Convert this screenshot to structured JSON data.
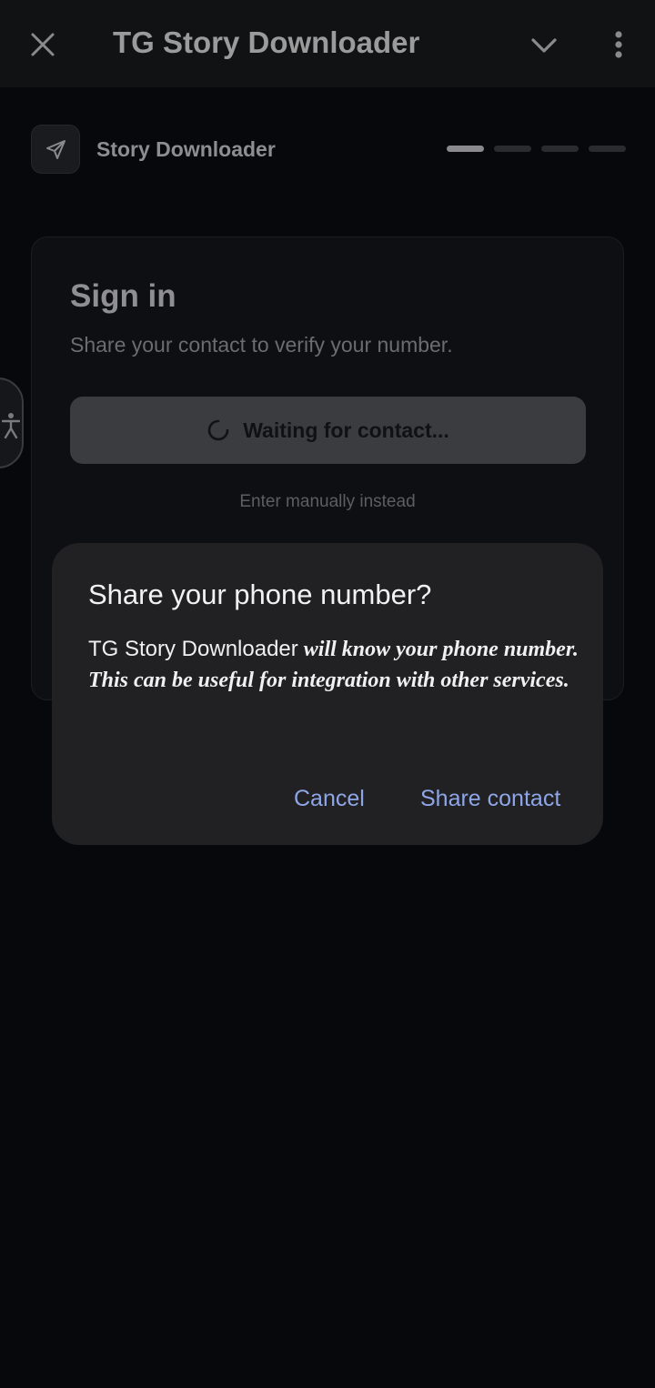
{
  "topbar": {
    "title": "TG Story Downloader",
    "close_icon": "close-icon",
    "collapse_icon": "chevron-down-icon",
    "menu_icon": "more-vertical-icon"
  },
  "header": {
    "app_name": "Story Downloader",
    "app_icon": "send-arrow-icon",
    "progress": {
      "current_step": 1,
      "total_steps": 4
    }
  },
  "card": {
    "heading": "Sign in",
    "subtext": "Share your contact to verify your number.",
    "waiting_label": "Waiting for contact...",
    "manual_link": "Enter manually instead"
  },
  "accessibility_icon": "accessibility-icon",
  "dialog": {
    "title": "Share your phone number?",
    "body_app": "TG Story Downloader",
    "body_rest": " will know your phone number. This can be useful for integration with other services.",
    "cancel_label": "Cancel",
    "confirm_label": "Share contact",
    "accent_color": "#8fa6e6"
  }
}
